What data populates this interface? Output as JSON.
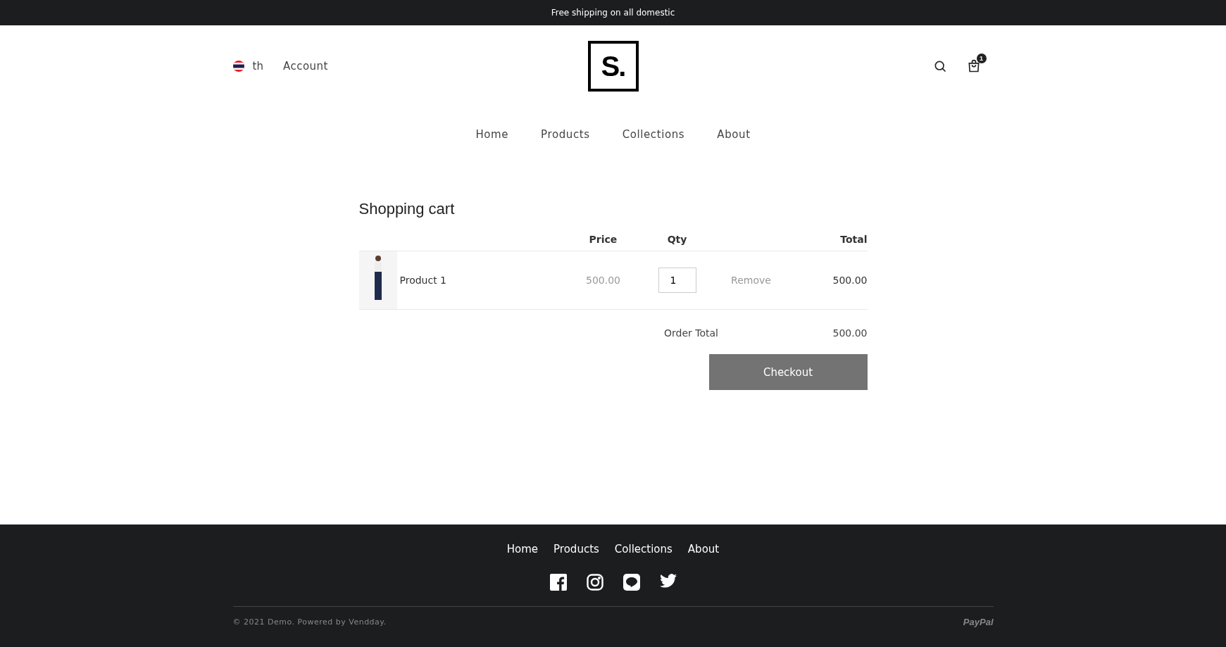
{
  "announcement": "Free shipping on all domestic",
  "header": {
    "language": "th",
    "account": "Account",
    "logo": "S.",
    "cart_count": "1"
  },
  "nav": [
    "Home",
    "Products",
    "Collections",
    "About"
  ],
  "cart": {
    "title": "Shopping cart",
    "columns": [
      "Price",
      "Qty",
      "Total"
    ],
    "items": [
      {
        "name": "Product 1",
        "price": "500.00",
        "qty": "1",
        "remove": "Remove",
        "total": "500.00"
      }
    ],
    "order_total_label": "Order Total",
    "order_total": "500.00",
    "checkout": "Checkout"
  },
  "footer": {
    "nav": [
      "Home",
      "Products",
      "Collections",
      "About"
    ],
    "copyright": "© 2021 Demo. Powered by Vendday.",
    "payment": "PayPal"
  }
}
